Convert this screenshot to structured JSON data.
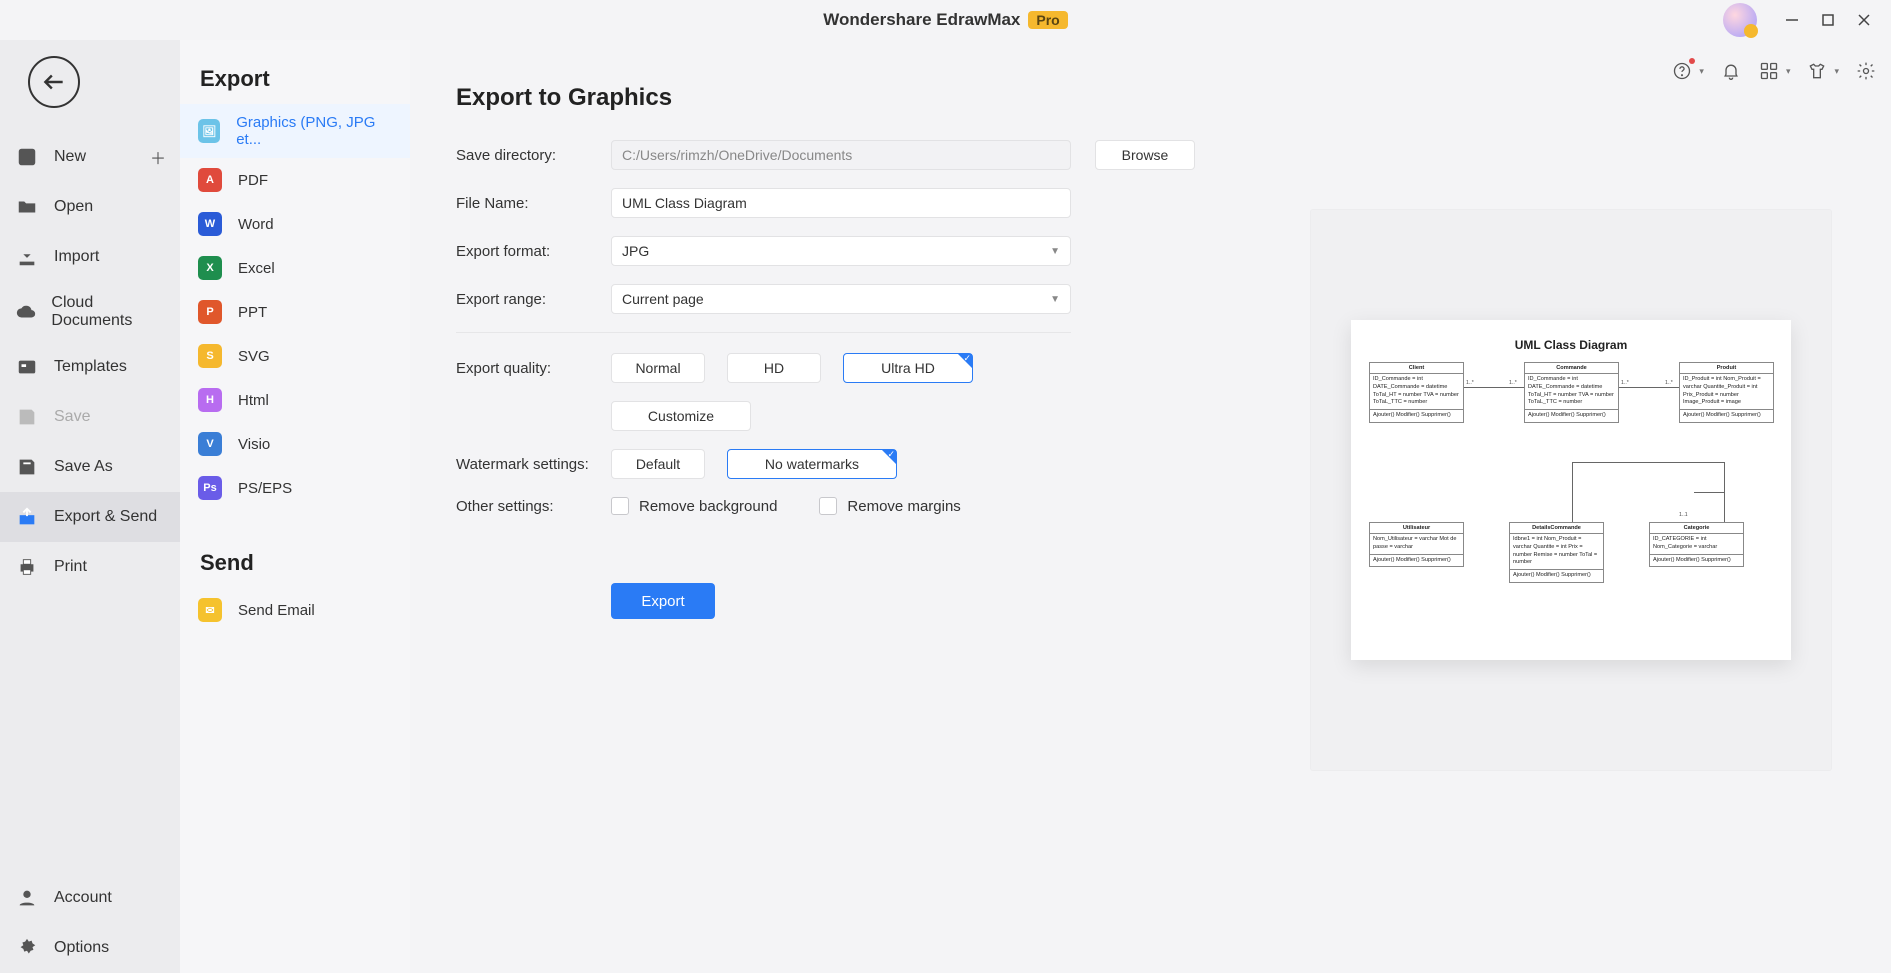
{
  "app": {
    "title": "Wondershare EdrawMax",
    "pro_badge": "Pro"
  },
  "sidebar1": {
    "new": "New",
    "open": "Open",
    "import": "Import",
    "cloud_documents": "Cloud Documents",
    "templates": "Templates",
    "save": "Save",
    "save_as": "Save As",
    "export_send": "Export & Send",
    "print": "Print",
    "account": "Account",
    "options": "Options"
  },
  "sidebar2": {
    "title": "Export",
    "send_title": "Send",
    "formats": {
      "graphics": "Graphics (PNG, JPG et...",
      "pdf": "PDF",
      "word": "Word",
      "excel": "Excel",
      "ppt": "PPT",
      "svg": "SVG",
      "html": "Html",
      "visio": "Visio",
      "pseps": "PS/EPS"
    },
    "send_email": "Send Email"
  },
  "form": {
    "title": "Export to Graphics",
    "labels": {
      "save_dir": "Save directory:",
      "file_name": "File Name:",
      "export_format": "Export format:",
      "export_range": "Export range:",
      "export_quality": "Export quality:",
      "watermark": "Watermark settings:",
      "other": "Other settings:"
    },
    "values": {
      "save_dir": "C:/Users/rimzh/OneDrive/Documents",
      "file_name": "UML Class Diagram",
      "export_format": "JPG",
      "export_range": "Current page"
    },
    "buttons": {
      "browse": "Browse",
      "customize": "Customize",
      "export": "Export"
    },
    "quality": {
      "normal": "Normal",
      "hd": "HD",
      "ultra_hd": "Ultra HD"
    },
    "watermark": {
      "default": "Default",
      "no_watermarks": "No watermarks"
    },
    "other": {
      "remove_bg": "Remove background",
      "remove_margins": "Remove margins"
    }
  },
  "preview": {
    "diagram_title": "UML Class Diagram",
    "boxes": {
      "client": {
        "name": "Client",
        "attrs": "ID_Commande = int\nDATE_Commande = datetime\nToTal_HT = number\nTVA = number\nToTaL_TTC = number",
        "methods": "Ajouter()\nModifier()\nSupprimer()"
      },
      "commande": {
        "name": "Commande",
        "attrs": "ID_Commande = int\nDATE_Commande = datetime\nToTal_HT = number\nTVA = number\nToTaL_TTC = number",
        "methods": "Ajouter()\nModifier()\nSupprimer()"
      },
      "produit": {
        "name": "Produit",
        "attrs": "ID_Produit = int\nNom_Produit = varchar\nQuantite_Produit = int\nPrix_Produit = number\nImage_Produit = image",
        "methods": "Ajouter()\nModifier()\nSupprimer()"
      },
      "utilisateur": {
        "name": "Utilisateur",
        "attrs": "Nom_Utilisateur = varchar\nMot de passe = varchar",
        "methods": "Ajouter()\nModifier()\nSupprimer()"
      },
      "detailscommande": {
        "name": "DetailsCommande",
        "attrs": "Idbne1 = int\nNom_Produit = varchar\nQuantite = int\nPrix = number\nRemise = number\nToTal = number",
        "methods": "Ajouter()\nModifier()\nSupprimer()"
      },
      "categorie": {
        "name": "Categorie",
        "attrs": "ID_CATEGORIE = int\nNom_Categorie = varchar",
        "methods": "Ajouter()\nModifier()\nSupprimer()"
      }
    },
    "cardinality": {
      "one_star_a": "1..*",
      "one_star_b": "1..*",
      "one_star_c": "1..*",
      "one_star_d": "1..*",
      "one_one": "1..1"
    }
  },
  "colors": {
    "accent": "#2a7bf5",
    "pro_badge_bg": "#f5b82e"
  }
}
